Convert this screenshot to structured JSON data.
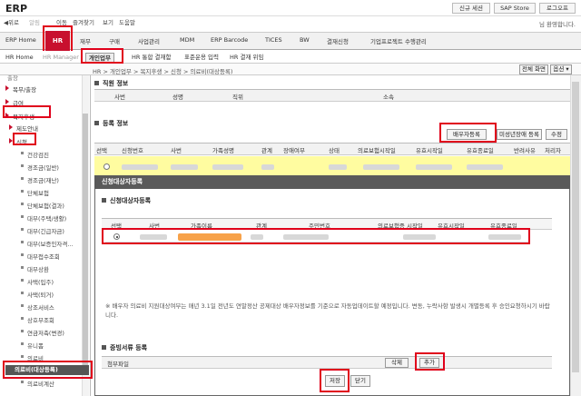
{
  "app": {
    "title": "ERP"
  },
  "topbar": {
    "buttons": [
      "신규 세션",
      "SAP Store",
      "로그오프"
    ]
  },
  "menubar": {
    "items": [
      "◀위로",
      "알림",
      "이동",
      "즐겨찾기",
      "보기",
      "도움말"
    ],
    "welcome": "님 환영합니다."
  },
  "tabs": [
    "ERP Home",
    "HR",
    "재무",
    "구매",
    "사업관리",
    "MDM",
    "ERP Barcode",
    "TICES",
    "BW",
    "결재신청",
    "기업프로젝트 수행관리"
  ],
  "subtabs": [
    "HR Home",
    "HR Manager",
    "개인업무",
    "HR 통합 결재함",
    "표준운용 입력",
    "HR 결재 위임"
  ],
  "breadcrumb": "HR > 개인업무 > 복지후생 > 신청 > 의료비(대상등록)",
  "page_actions": [
    "전체 화면",
    "옵션 ▾"
  ],
  "sidebar": {
    "items": [
      "출장",
      "복무/출장",
      "급여",
      "복지후생",
      "제도안내",
      "신청",
      "건강검진",
      "경조금(일반)",
      "경조금(재난)",
      "단체보험",
      "단체보험(결과)",
      "대부(주택/생활)",
      "대부(긴급자금)",
      "대부(보증인자격...",
      "대부접수조회",
      "대부상환",
      "사택(입주)",
      "사택(퇴거)",
      "상조서비스",
      "상호부조회",
      "연금저축(변경)",
      "유니폼",
      "의료비",
      "의료비(대상등록)",
      "의료비계산"
    ]
  },
  "staff_section": {
    "title": "직원 정보",
    "headers": [
      "사번",
      "성명",
      "직위",
      "소속"
    ]
  },
  "reg_section": {
    "title": "등록 정보",
    "buttons": [
      "배우자등록",
      "미성년장애 등록",
      "수정"
    ],
    "headers": [
      "선택",
      "신청번호",
      "사번",
      "가족성명",
      "관계",
      "장애여부",
      "상태",
      "의료보험시작일",
      "유효시작일",
      "유효종료일",
      "반려사유",
      "처리자"
    ]
  },
  "modal": {
    "title": "신청대상자등록",
    "section": "신청대상자등록",
    "headers": [
      "선택",
      "사번",
      "가족이름",
      "관계",
      "주민번호",
      "의료보험증 시작일",
      "유효시작일",
      "유효종료일"
    ],
    "note": "※ 배우자 의료비 지원대상여부는 매년 3.1일 전년도 연말정산 공제대상 배우자정보를 기준으로 자동업데이트할 예정입니다. 변동, 누락사항 발생시 개별등록 후 승인요청하시기 바랍니다.",
    "attach_section": "증빙서류 등록",
    "attach_label": "첨부파일",
    "attach_buttons": [
      "삭제",
      "추가"
    ],
    "save_label": "저장",
    "close_label": "닫기"
  }
}
